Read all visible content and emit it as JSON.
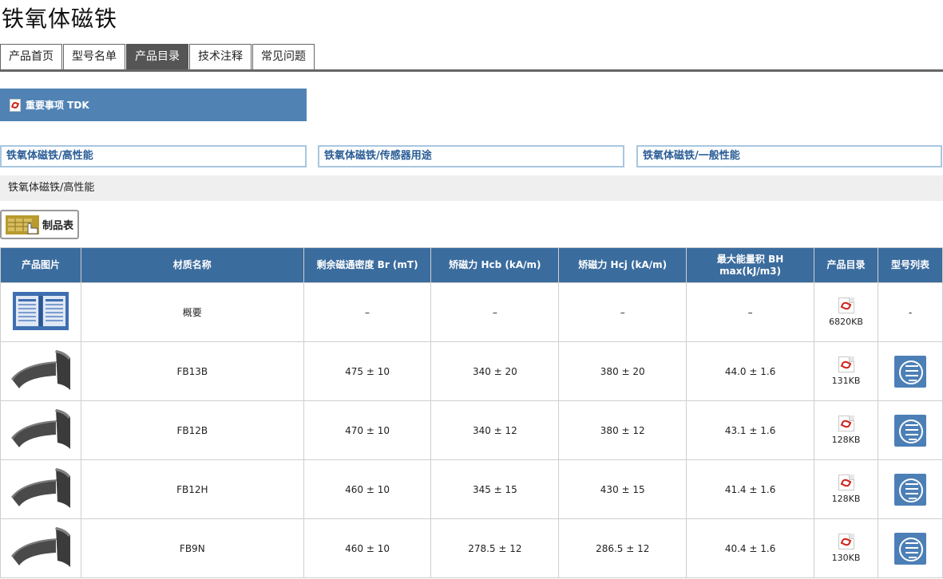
{
  "page": {
    "title": "铁氧体磁铁"
  },
  "tabs": [
    {
      "label": "产品首页",
      "active": false
    },
    {
      "label": "型号名单",
      "active": false
    },
    {
      "label": "产品目录",
      "active": true
    },
    {
      "label": "技术注释",
      "active": false
    },
    {
      "label": "常见问题",
      "active": false
    }
  ],
  "notice": {
    "label": "重要事项 TDK",
    "icon": "pdf-icon"
  },
  "categories": [
    "铁氧体磁铁/高性能",
    "铁氧体磁铁/传感器用途",
    "铁氧体磁铁/一般性能"
  ],
  "section": {
    "title": "铁氧体磁铁/高性能"
  },
  "product_table_button": {
    "label": "制品表",
    "icon": "product-table-hand-icon"
  },
  "table": {
    "headers": {
      "image": "产品图片",
      "material": "材质名称",
      "br": "剩余磁通密度 Br (mT)",
      "hcb": "矫磁力 Hcb (kA/m)",
      "hcj": "矫磁力 Hcj (kA/m)",
      "bh_line1": "最大能量积 BH",
      "bh_line2": "max(kJ/m3)",
      "catalog": "产品目录",
      "list": "型号列表"
    },
    "rows": [
      {
        "image": "catalog-overview-image",
        "material": "概要",
        "br": "–",
        "hcb": "–",
        "hcj": "–",
        "bh": "–",
        "catalog_size": "6820KB",
        "list": "-"
      },
      {
        "image": "arc-magnet-image",
        "material": "FB13B",
        "br": "475 ± 10",
        "hcb": "340 ± 20",
        "hcj": "380 ± 20",
        "bh": "44.0 ± 1.6",
        "catalog_size": "131KB",
        "list": "model-list-icon"
      },
      {
        "image": "arc-magnet-image",
        "material": "FB12B",
        "br": "470 ± 10",
        "hcb": "340 ± 12",
        "hcj": "380 ± 12",
        "bh": "43.1 ± 1.6",
        "catalog_size": "128KB",
        "list": "model-list-icon"
      },
      {
        "image": "arc-magnet-image",
        "material": "FB12H",
        "br": "460 ± 10",
        "hcb": "345 ± 15",
        "hcj": "430 ± 15",
        "bh": "41.4 ± 1.6",
        "catalog_size": "128KB",
        "list": "model-list-icon"
      },
      {
        "image": "arc-magnet-image",
        "material": "FB9N",
        "br": "460 ± 10",
        "hcb": "278.5 ± 12",
        "hcj": "286.5 ± 12",
        "bh": "40.4 ± 1.6",
        "catalog_size": "130KB",
        "list": "model-list-icon"
      }
    ]
  },
  "colors": {
    "header_blue": "#3b6c9e",
    "notice_blue": "#5083b4",
    "category_border": "#a8c6e0",
    "category_text": "#2a5d96",
    "active_tab": "#555555"
  }
}
